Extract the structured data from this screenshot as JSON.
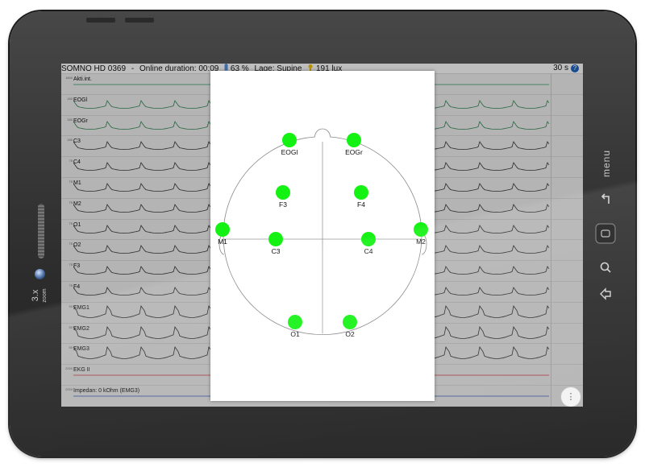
{
  "device": {
    "zoom_label": "3.x",
    "zoom_sub": "zoom",
    "menu_label": "menu"
  },
  "status_bar": {
    "device_name": "SOMNO HD 0369",
    "online_duration": "Online duration: 00:09",
    "battery": "63 %",
    "position": "Lage: Supine",
    "light": "191 lux",
    "time_window": "30 s",
    "help_icon": "?"
  },
  "channels": [
    {
      "label": "Akti.int.",
      "scale": "1600"
    },
    {
      "label": "EOGl",
      "scale": "150"
    },
    {
      "label": "EOGr",
      "scale": "150"
    },
    {
      "label": "C3",
      "scale": "150"
    },
    {
      "label": "C4",
      "scale": "75"
    },
    {
      "label": "M1",
      "scale": "75"
    },
    {
      "label": "M2",
      "scale": "75"
    },
    {
      "label": "O1",
      "scale": "75"
    },
    {
      "label": "O2",
      "scale": "75"
    },
    {
      "label": "F3",
      "scale": "75"
    },
    {
      "label": "F4",
      "scale": "75"
    },
    {
      "label": "EMG1",
      "scale": "50"
    },
    {
      "label": "EMG2",
      "scale": "50"
    },
    {
      "label": "EMG3",
      "scale": "50"
    },
    {
      "label": "EKG II",
      "scale": "2000"
    },
    {
      "label": "Impedan: 0 kOhm (EMG3)",
      "scale": "2000"
    }
  ],
  "electrode_map": {
    "electrodes": [
      {
        "id": "EOGl",
        "status_color": "#14f214"
      },
      {
        "id": "EOGr",
        "status_color": "#14f214"
      },
      {
        "id": "F3",
        "status_color": "#14f214"
      },
      {
        "id": "F4",
        "status_color": "#14f214"
      },
      {
        "id": "M1",
        "status_color": "#14f214"
      },
      {
        "id": "C3",
        "status_color": "#14f214"
      },
      {
        "id": "C4",
        "status_color": "#14f214"
      },
      {
        "id": "M2",
        "status_color": "#14f214"
      },
      {
        "id": "O1",
        "status_color": "#14f214"
      },
      {
        "id": "O2",
        "status_color": "#14f214"
      }
    ]
  },
  "fab_icon": "more-vertical-icon"
}
